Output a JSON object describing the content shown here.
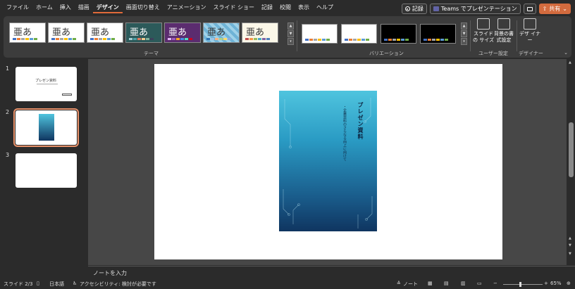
{
  "menu": {
    "tabs": [
      "ファイル",
      "ホーム",
      "挿入",
      "描画",
      "デザイン",
      "画面切り替え",
      "アニメーション",
      "スライド ショー",
      "記録",
      "校閲",
      "表示",
      "ヘルプ"
    ],
    "active_tab": "デザイン",
    "record_label": "記録",
    "teams_label": "Teams でプレゼンテーション",
    "share_label": "共有"
  },
  "ribbon": {
    "themes_group_label": "テーマ",
    "variants_group_label": "バリエーション",
    "user_settings_group_label": "ユーザー設定",
    "designer_group_label": "デザイナー",
    "theme_glyph": "亜あ",
    "slide_size_label": "スライドの サイズ",
    "bg_format_label": "背景の書 式設定",
    "designer_label": "デザ イナー"
  },
  "slides": {
    "numbers": [
      "1",
      "2",
      "3"
    ],
    "thumb1_title": "プレゼン資料"
  },
  "slide_content": {
    "title": "プレゼン資料",
    "subtitle": "・企業資料のさらなる向上に向けて"
  },
  "notes_placeholder": "ノートを入力",
  "status": {
    "slide_count": "スライド 2/3",
    "language": "日本語",
    "accessibility": "アクセシビリティ: 検討が必要です",
    "notes_label": "ノート",
    "zoom": "65%"
  }
}
